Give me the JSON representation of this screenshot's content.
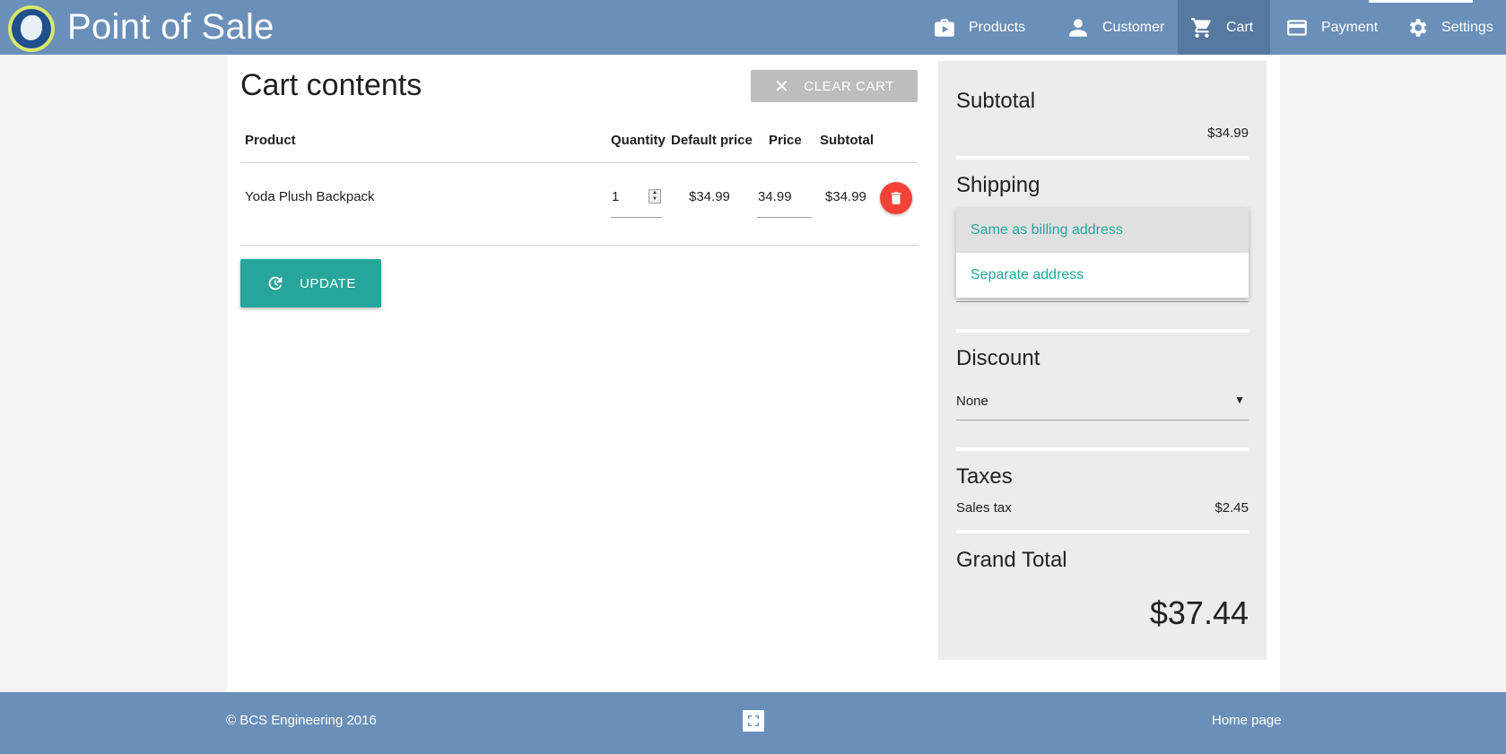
{
  "header": {
    "title": "Point of Sale",
    "nav": [
      {
        "label": "Products",
        "icon": "briefcase-icon"
      },
      {
        "label": "Customer",
        "icon": "person-icon"
      },
      {
        "label": "Cart",
        "icon": "cart-icon",
        "active": true
      },
      {
        "label": "Payment",
        "icon": "credit-card-icon"
      },
      {
        "label": "Settings",
        "icon": "gear-icon"
      }
    ]
  },
  "cart": {
    "title": "Cart contents",
    "clear_label": "CLEAR CART",
    "columns": [
      "Product",
      "Quantity",
      "Default price",
      "Price",
      "Subtotal"
    ],
    "rows": [
      {
        "product": "Yoda Plush Backpack",
        "quantity": "1",
        "default_price": "$34.99",
        "price": "34.99",
        "subtotal": "$34.99"
      }
    ],
    "update_label": "UPDATE"
  },
  "summary": {
    "subtotal_heading": "Subtotal",
    "subtotal_value": "$34.99",
    "shipping_heading": "Shipping",
    "shipping_options": [
      "Same as billing address",
      "Separate address"
    ],
    "discount_heading": "Discount",
    "discount_value": "None",
    "taxes_heading": "Taxes",
    "tax_label": "Sales tax",
    "tax_value": "$2.45",
    "grand_total_heading": "Grand Total",
    "grand_total_value": "$37.44"
  },
  "footer": {
    "copyright": "© BCS Engineering 2016",
    "home_link": "Home page"
  },
  "colors": {
    "header": "#6a8fb8",
    "accent": "#26a69a",
    "danger": "#f44336"
  }
}
